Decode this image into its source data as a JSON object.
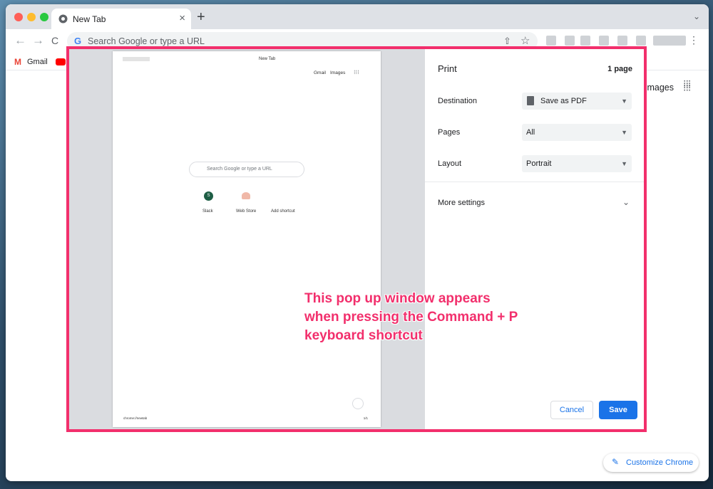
{
  "browser": {
    "tab_title": "New Tab",
    "tab_close": "×",
    "new_tab": "+",
    "tab_menu": "⌄",
    "back": "←",
    "forward": "→",
    "reload": "C",
    "omnibox_g": "G",
    "omnibox_placeholder": "Search Google or type a URL",
    "share": "⇧",
    "star": "☆",
    "menu": "⋮"
  },
  "bookmarks": [
    {
      "label": "Gmail",
      "icon": "gmail-icon"
    },
    {
      "label": "",
      "icon": "youtube-icon"
    }
  ],
  "new_tab_page": {
    "images_link": "Images",
    "apps_icon": "⁝⁝⁝",
    "customize_icon": "✎",
    "customize_label": "Customize Chrome"
  },
  "print_preview": {
    "page_title": "New Tab",
    "gmail": "Gmail",
    "images": "Images",
    "apps": "⁝⁝⁝",
    "search_placeholder": "Search Google or type a URL",
    "shortcuts": [
      {
        "label": "Slack",
        "icon_text": "S"
      },
      {
        "label": "Web Store",
        "icon_text": ""
      },
      {
        "label": "Add shortcut",
        "icon_text": ""
      }
    ],
    "footer_left": "chrome://newtab",
    "footer_right": "1/1"
  },
  "print_panel": {
    "title": "Print",
    "page_count": "1 page",
    "destination_label": "Destination",
    "destination_value": "Save as PDF",
    "pages_label": "Pages",
    "pages_value": "All",
    "layout_label": "Layout",
    "layout_value": "Portrait",
    "more_settings": "More settings",
    "more_chevron": "⌄",
    "caret": "▼",
    "cancel": "Cancel",
    "save": "Save"
  },
  "annotation": "This pop up window appears when pressing the Command + P keyboard shortcut",
  "colors": {
    "annotation_border": "#f22f6c",
    "accent_blue": "#1a73e8"
  }
}
